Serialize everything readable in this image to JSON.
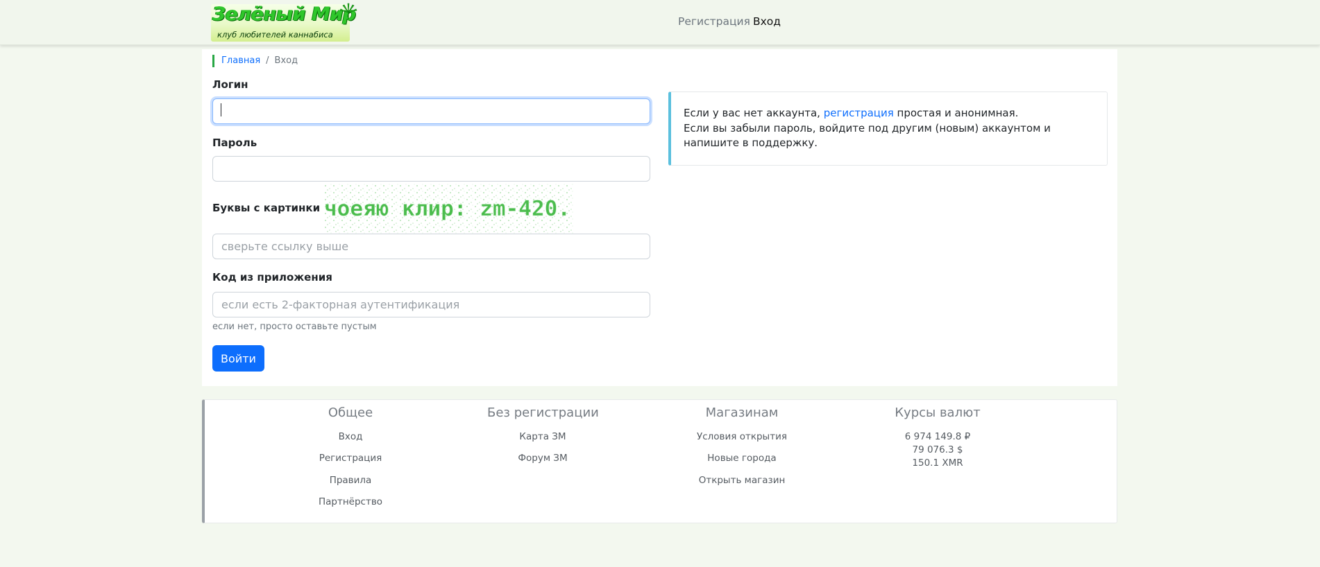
{
  "header": {
    "logo_title": "Зелёный Мир",
    "logo_subtitle": "клуб любителей каннабиса",
    "nav": {
      "register": "Регистрация",
      "login": "Вход"
    }
  },
  "breadcrumb": {
    "home": "Главная",
    "separator": "/",
    "current": "Вход"
  },
  "form": {
    "login_label": "Логин",
    "login_value": "",
    "password_label": "Пароль",
    "password_value": "",
    "captcha_label": "Буквы с картинки",
    "captcha_text": "чоеяю клир: zm-420.",
    "captcha_placeholder": "сверьте ссылку выше",
    "code_label": "Код из приложения",
    "code_placeholder": "если есть 2-факторная аутентификация",
    "code_help": "если нет, просто оставьте пустым",
    "submit_label": "Войти"
  },
  "info": {
    "line1_prefix": "Если у вас нет аккаунта, ",
    "line1_link": "регистрация",
    "line1_suffix": " простая и анонимная.",
    "line2": "Если вы забыли пароль, войдите под другим (новым) аккаунтом и напишите в поддержку."
  },
  "footer": {
    "columns": [
      {
        "title": "Общее",
        "links": [
          "Вход",
          "Регистрация",
          "Правила",
          "Партнёрство"
        ]
      },
      {
        "title": "Без регистрации",
        "links": [
          "Карта ЗМ",
          "Форум ЗМ"
        ]
      },
      {
        "title": "Магазинам",
        "links": [
          "Условия открытия",
          "Новые города",
          "Открыть магазин"
        ]
      },
      {
        "title": "Курсы валют",
        "lines": [
          "6 974 149.8 ₽",
          "79 076.3 $",
          "150.1 XMR"
        ]
      }
    ]
  },
  "colors": {
    "accent": "#0d6efd",
    "brand_green": "#28a745",
    "info_border": "#5bc0de",
    "page_bg": "#f3f8ef"
  },
  "icons": {
    "logo_leaf": "cannabis-leaf-icon"
  }
}
